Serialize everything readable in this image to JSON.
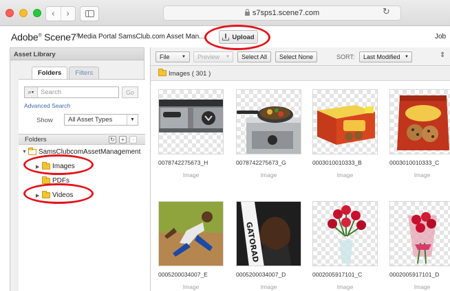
{
  "browser": {
    "url": "s7sps1.scene7.com",
    "nav_back": "‹",
    "nav_forward": "›",
    "reload_glyph": "↻"
  },
  "header": {
    "brand": "Adobe",
    "brand_rest": "Scene7",
    "portal": "Media Portal   SamsClub.com Asset Man...",
    "upload_label": "Upload",
    "job_label": "Job"
  },
  "highlight_color": "#e3131b",
  "left_panel": {
    "title": "Asset Library",
    "tabs": [
      "Folders",
      "Filters"
    ],
    "search_placeholder": "Search",
    "go_label": "Go",
    "advanced_search": "Advanced Search",
    "show_label": "Show",
    "asset_type": "All Asset Types",
    "folders_title": "Folders",
    "tree": {
      "root": "SamsClubcomAssetManagement",
      "children": [
        "Images",
        "PDFs",
        "Videos"
      ]
    }
  },
  "toolbar": {
    "file": "File",
    "preview": "Preview",
    "select_all": "Select All",
    "select_none": "Select None",
    "sort_label": "SORT:",
    "sort_value": "Last Modified"
  },
  "path": {
    "label": "Images ( 301 )"
  },
  "assets": [
    {
      "name": "0078742275673_H",
      "type": "Image",
      "icon": "grill-burner-image"
    },
    {
      "name": "0078742275673_G",
      "type": "Image",
      "icon": "grill-pan-image"
    },
    {
      "name": "0003010010333_B",
      "type": "Image",
      "icon": "cookies-box-image"
    },
    {
      "name": "0003010010333_C",
      "type": "Image",
      "icon": "cookies-bag-image"
    },
    {
      "name": "0005200034007_E",
      "type": "Image",
      "icon": "sprinters-image"
    },
    {
      "name": "0005200034007_D",
      "type": "Image",
      "icon": "athlete-towel-image"
    },
    {
      "name": "0002005917101_C",
      "type": "Image",
      "icon": "roses-vase-image"
    },
    {
      "name": "0002005917101_D",
      "type": "Image",
      "icon": "roses-bouquet-image"
    }
  ]
}
